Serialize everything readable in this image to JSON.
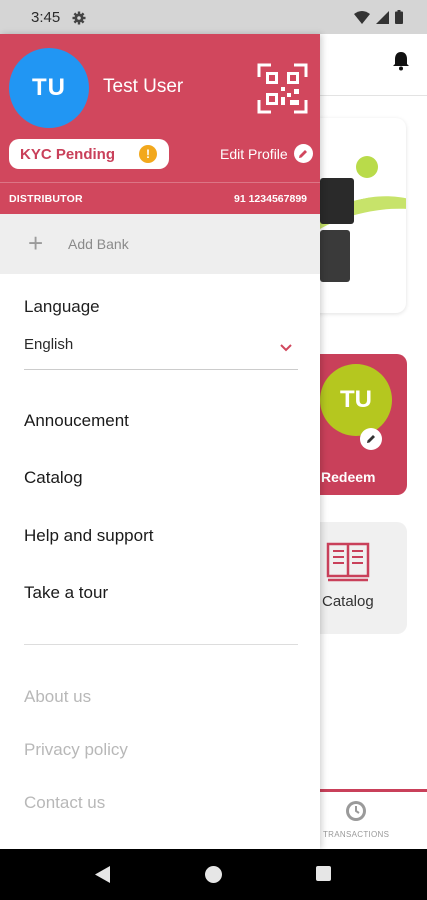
{
  "status_bar": {
    "time": "3:45"
  },
  "background": {
    "redeem_avatar_initials": "TU",
    "redeem_label": "Redeem",
    "catalog_label": "Catalog",
    "transactions_label": "TRANSACTIONS"
  },
  "drawer": {
    "avatar_initials": "TU",
    "user_name": "Test User",
    "kyc_status": "KYC Pending",
    "kyc_alert": "!",
    "edit_profile_label": "Edit Profile",
    "role": "DISTRIBUTOR",
    "phone": "91 1234567899",
    "add_bank_label": "Add Bank",
    "language": {
      "title": "Language",
      "selected": "English"
    },
    "menu_items": [
      "Annoucement",
      "Catalog",
      "Help and support",
      "Take a tour"
    ],
    "footer_links": [
      "About us",
      "Privacy policy",
      "Contact us"
    ]
  },
  "colors": {
    "brand": "#d1475d",
    "avatar": "#2196f3",
    "warning": "#f2a81d"
  },
  "icons": {
    "qr": "qr-code-icon",
    "edit": "pencil-icon",
    "add": "plus-icon",
    "chevron": "chevron-down-icon",
    "bell": "bell-icon"
  }
}
